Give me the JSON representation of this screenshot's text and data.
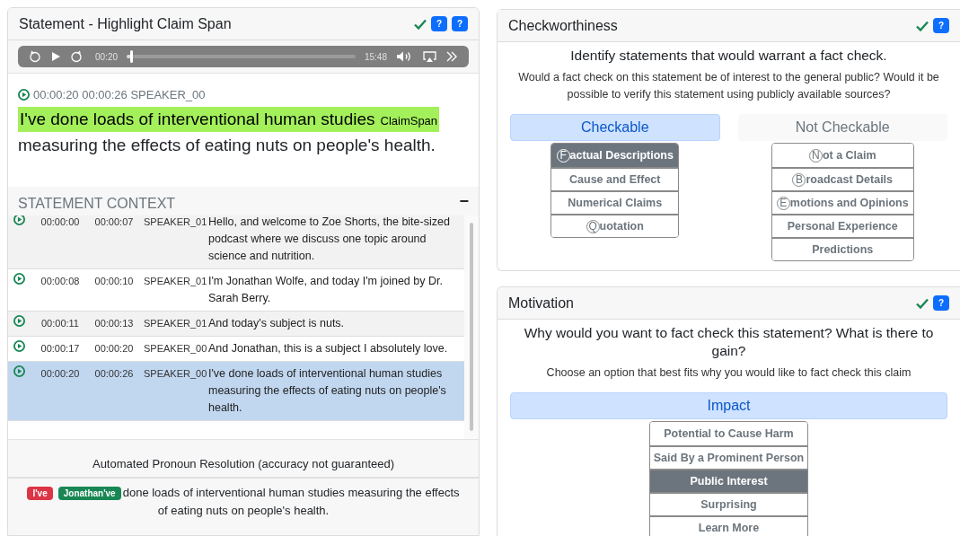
{
  "statement_panel": {
    "title": "Statement - Highlight Claim Span",
    "checked": true,
    "help_buttons": [
      "?",
      "?"
    ],
    "player": {
      "elapsed": "00:20",
      "level": 0.02,
      "duration": "15:48"
    },
    "statement": {
      "start": "00:00:20",
      "end": "00:00:26",
      "speaker": "SPEAKER_00",
      "claim_span": "I've done loads of interventional human studies",
      "span_label": "ClaimSpan",
      "rest": "measuring the effects of eating nuts on people's health."
    },
    "context": {
      "title": "STATEMENT CONTEXT",
      "collapse": "−",
      "rows": [
        {
          "start": "00:00:00",
          "end": "00:00:07",
          "speaker": "SPEAKER_01",
          "text": "Hello, and welcome to Zoe Shorts, the bite-sized podcast where we discuss one topic around science and nutrition.",
          "selected": false
        },
        {
          "start": "00:00:08",
          "end": "00:00:10",
          "speaker": "SPEAKER_01",
          "text": "I'm Jonathan Wolfe, and today I'm joined by Dr. Sarah Berry.",
          "selected": false
        },
        {
          "start": "00:00:11",
          "end": "00:00:13",
          "speaker": "SPEAKER_01",
          "text": "And today's subject is nuts.",
          "selected": false
        },
        {
          "start": "00:00:17",
          "end": "00:00:20",
          "speaker": "SPEAKER_00",
          "text": "And Jonathan, this is a subject I absolutely love.",
          "selected": false
        },
        {
          "start": "00:00:20",
          "end": "00:00:26",
          "speaker": "SPEAKER_00",
          "text": "I've done loads of interventional human studies measuring the effects of eating nuts on people's health.",
          "selected": true
        }
      ]
    },
    "pronoun_title": "Automated Pronoun Resolution (accuracy not guaranteed)",
    "pronoun": {
      "original": "I've",
      "resolved": "Jonathan've",
      "rest": "done loads of interventional human studies measuring the effects of eating nuts on people's health."
    }
  },
  "checkworthiness": {
    "title": "Checkworthiness",
    "checked": true,
    "help": "?",
    "question": "Identify statements that would warrant a fact check.",
    "description": "Would a fact check on this statement be of interest to the general public? Would it be possible to verify this statement using publicly available sources?",
    "categories": [
      {
        "label": "Checkable",
        "selected": true,
        "options": [
          {
            "hotkey": "F",
            "label": "actual Descriptions",
            "selected": true
          },
          {
            "label": "Cause and Effect",
            "selected": false
          },
          {
            "label": "Numerical Claims",
            "selected": false
          },
          {
            "hotkey": "Q",
            "label": "uotation",
            "selected": false
          }
        ]
      },
      {
        "label": "Not Checkable",
        "selected": false,
        "options": [
          {
            "hotkey": "N",
            "label": "ot a Claim",
            "selected": false
          },
          {
            "hotkey": "B",
            "label": "roadcast Details",
            "selected": false
          },
          {
            "hotkey": "E",
            "label": "motions and Opinions",
            "selected": false
          },
          {
            "label": "Personal Experience",
            "selected": false
          },
          {
            "label": "Predictions",
            "selected": false
          }
        ]
      }
    ]
  },
  "motivation": {
    "title": "Motivation",
    "checked": true,
    "help": "?",
    "question": "Why would you want to fact check this statement? What is there to gain?",
    "description": "Choose an option that best fits why you would like to fact check this claim",
    "categories": [
      {
        "label": "Impact",
        "selected": true,
        "options": [
          {
            "label": "Potential to Cause Harm",
            "selected": false
          },
          {
            "label": "Said By a Prominent Person",
            "selected": false
          },
          {
            "label": "Public Interest",
            "selected": true
          },
          {
            "label": "Surprising",
            "selected": false
          },
          {
            "label": "Learn More",
            "selected": false
          }
        ]
      }
    ]
  }
}
